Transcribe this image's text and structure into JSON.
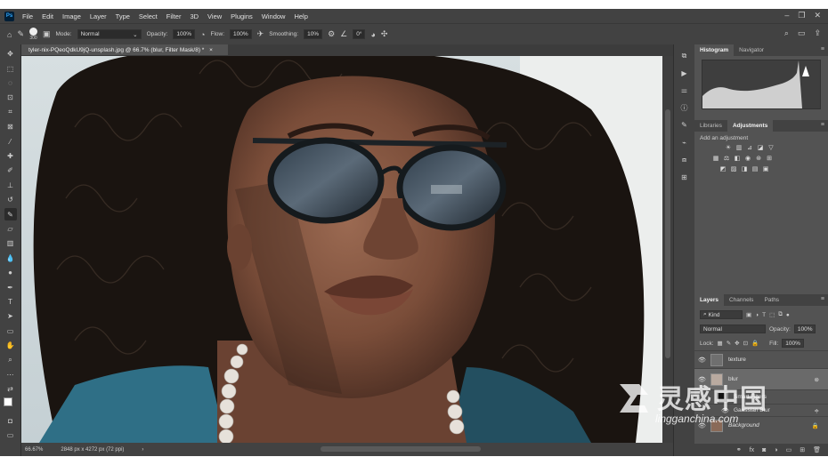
{
  "menu": [
    "File",
    "Edit",
    "Image",
    "Layer",
    "Type",
    "Select",
    "Filter",
    "3D",
    "View",
    "Plugins",
    "Window",
    "Help"
  ],
  "window_controls": {
    "minimize": "–",
    "restore": "❐",
    "close": "✕"
  },
  "options_bar": {
    "brush_size": "300",
    "mode_label": "Mode:",
    "mode_value": "Normal",
    "opacity_label": "Opacity:",
    "opacity_value": "100%",
    "flow_label": "Flow:",
    "flow_value": "100%",
    "smoothing_label": "Smoothing:",
    "smoothing_value": "10%",
    "angle_value": "0°"
  },
  "document": {
    "tab_title": "tyler-nix-PQeoQdkU9jQ-unsplash.jpg @ 66.7% (blur, Filter Mask/8) *",
    "zoom": "66.67%",
    "doc_info": "2848 px x 4272 px (72 ppi)"
  },
  "panels": {
    "top_tabs": [
      "Histogram",
      "Navigator"
    ],
    "mid_tabs": [
      "Libraries",
      "Adjustments"
    ],
    "add_adjustment": "Add an adjustment",
    "layer_tabs": [
      "Layers",
      "Channels",
      "Paths"
    ],
    "kind_label": "Kind",
    "blend_mode": "Normal",
    "opacity_label": "Opacity:",
    "opacity_value": "100%",
    "lock_label": "Lock:",
    "fill_label": "Fill:",
    "fill_value": "100%"
  },
  "layers": [
    {
      "name": "texture"
    },
    {
      "name": "blur"
    },
    {
      "name": "Smart Filters"
    },
    {
      "name": "Gaussian Blur"
    },
    {
      "name": "Background"
    }
  ],
  "watermark": {
    "title": "灵感中国",
    "url": "lingganchina.com"
  },
  "colors": {
    "accent": "#31a8ff",
    "panel": "#535353",
    "chrome": "#424242"
  }
}
